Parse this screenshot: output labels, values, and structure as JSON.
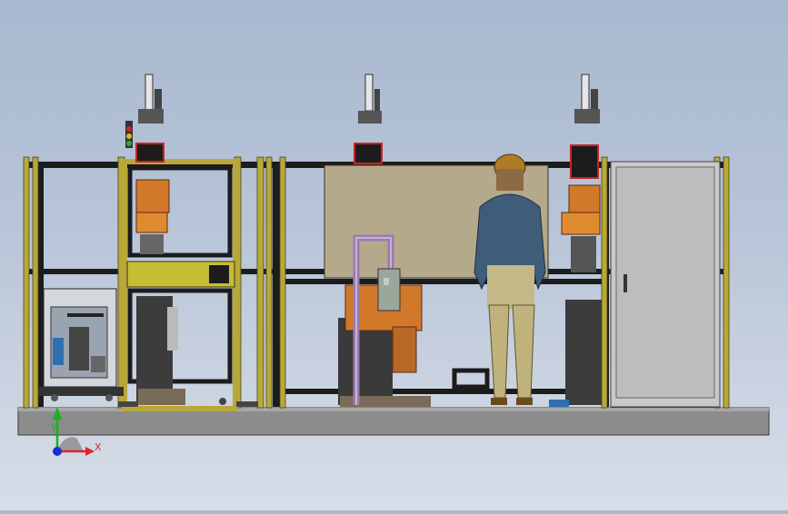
{
  "scene": {
    "title": "",
    "description_visible": false
  },
  "triad": {
    "x_label": "X",
    "y_label": "Y",
    "x_color": "#e0242b",
    "y_color": "#18b31c",
    "z_color": "#1b2bd6"
  },
  "colors": {
    "frame_yellow": "#b8a83a",
    "frame_black": "#1a1a1a",
    "robot_orange": "#d2782a",
    "base_gray": "#8a8a8a",
    "panel_tan": "#b5a98c",
    "cabinet_gray": "#c9c9c9",
    "pipe_purple": "#9b7bb0"
  }
}
